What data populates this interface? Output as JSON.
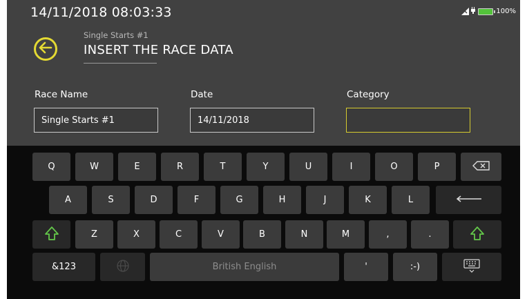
{
  "status": {
    "datetime": "14/11/2018  08:03:33",
    "battery": "100%"
  },
  "header": {
    "subtitle": "Single Starts #1",
    "title": "INSERT THE RACE DATA"
  },
  "form": {
    "race_name_label": "Race Name",
    "race_name_value": "Single Starts #1",
    "date_label": "Date",
    "date_value": "14/11/2018",
    "category_label": "Category",
    "category_value": ""
  },
  "keyboard": {
    "row1": [
      "Q",
      "W",
      "E",
      "R",
      "T",
      "Y",
      "U",
      "I",
      "O",
      "P"
    ],
    "row2": [
      "A",
      "S",
      "D",
      "F",
      "G",
      "H",
      "J",
      "K",
      "L"
    ],
    "row3": [
      "Z",
      "X",
      "C",
      "V",
      "B",
      "N",
      "M",
      ",",
      "."
    ],
    "symbols_label": "&123",
    "space_label": "British English",
    "apostrophe": "'",
    "smiley": ":-)"
  },
  "colors": {
    "accent": "#e4da33",
    "shift": "#64c84a",
    "background": "#414141",
    "keyboard_bg": "#0b0b0b"
  },
  "icons": {
    "back": "back-arrow-icon",
    "backspace": "backspace-icon",
    "enter": "enter-icon",
    "shift": "shift-icon",
    "globe": "globe-icon",
    "hide_keyboard": "keyboard-hide-icon",
    "battery": "battery-icon",
    "signal": "signal-icon"
  }
}
